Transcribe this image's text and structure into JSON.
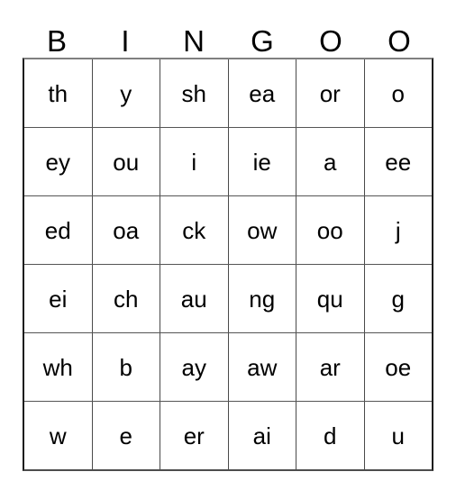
{
  "card": {
    "headers": [
      "B",
      "I",
      "N",
      "G",
      "O",
      "O"
    ],
    "rows": [
      [
        "th",
        "y",
        "sh",
        "ea",
        "or",
        "o"
      ],
      [
        "ey",
        "ou",
        "i",
        "ie",
        "a",
        "ee"
      ],
      [
        "ed",
        "oa",
        "ck",
        "ow",
        "oo",
        "j"
      ],
      [
        "ei",
        "ch",
        "au",
        "ng",
        "qu",
        "g"
      ],
      [
        "wh",
        "b",
        "ay",
        "aw",
        "ar",
        "oe"
      ],
      [
        "w",
        "e",
        "er",
        "ai",
        "d",
        "u"
      ]
    ]
  },
  "colors": {
    "background": "#ffffff",
    "text": "#000000",
    "grid_line": "#4a4a4a",
    "grid_line_light": "#808080"
  }
}
